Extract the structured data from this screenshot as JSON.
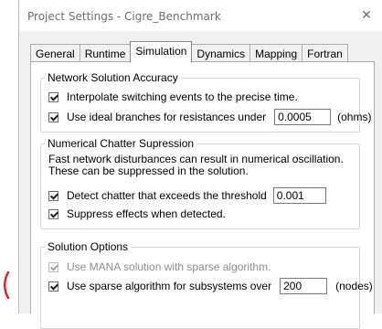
{
  "window": {
    "title": "Project Settings - Cigre_Benchmark",
    "close_glyph": "✕"
  },
  "tabs": [
    {
      "label": "General",
      "active": false
    },
    {
      "label": "Runtime",
      "active": false
    },
    {
      "label": "Simulation",
      "active": true
    },
    {
      "label": "Dynamics",
      "active": false
    },
    {
      "label": "Mapping",
      "active": false
    },
    {
      "label": "Fortran",
      "active": false
    }
  ],
  "network_accuracy": {
    "legend": "Network Solution Accuracy",
    "interpolate": {
      "label": "Interpolate switching events to the precise time.",
      "checked": true
    },
    "ideal_branches": {
      "label": "Use ideal branches for resistances under",
      "checked": true,
      "value": "0.0005",
      "unit": "(ohms)"
    }
  },
  "chatter": {
    "legend": "Numerical Chatter Supression",
    "description": "Fast network disturbances can result in numerical oscillation. These can be suppressed in the solution.",
    "detect": {
      "label": "Detect chatter that exceeds the threshold",
      "checked": true,
      "value": "0.001"
    },
    "suppress": {
      "label": "Suppress effects when detected.",
      "checked": true
    }
  },
  "solution_options": {
    "legend": "Solution Options",
    "mana": {
      "label": "Use MANA solution with sparse algorithm.",
      "checked": true,
      "disabled": true
    },
    "sparse": {
      "label": "Use sparse algorithm for subsystems over",
      "checked": true,
      "value": "200",
      "unit": "(nodes)"
    }
  },
  "colors": {
    "annotation_mark": "#e0242a",
    "tab_border": "#adadad",
    "group_border": "#d5d5d5"
  }
}
